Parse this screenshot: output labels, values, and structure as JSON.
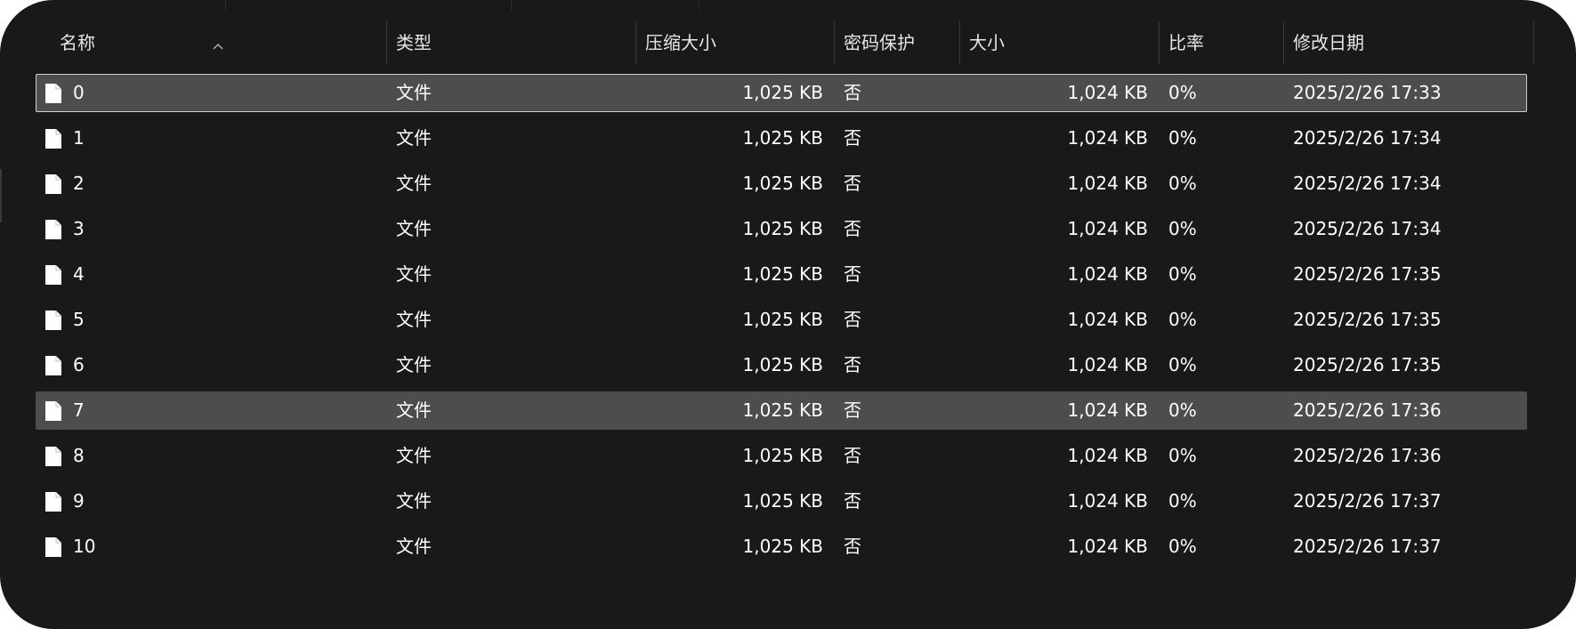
{
  "colors": {
    "background": "#191919",
    "selected_row": "#4d4d4d",
    "focus_border": "#d0d0d0",
    "text": "#ffffff"
  },
  "columns": {
    "name": "名称",
    "type": "类型",
    "compressed_size": "压缩大小",
    "password": "密码保护",
    "size": "大小",
    "ratio": "比率",
    "modified": "修改日期"
  },
  "sort": {
    "column": "name",
    "direction": "ascending",
    "icon": "chevron-up-icon"
  },
  "rows": [
    {
      "name": "0",
      "type": "文件",
      "compressed_size": "1,025 KB",
      "password": "否",
      "size": "1,024 KB",
      "ratio": "0%",
      "modified": "2025/2/26 17:33",
      "icon": "file-icon",
      "selected": true,
      "focused": true
    },
    {
      "name": "1",
      "type": "文件",
      "compressed_size": "1,025 KB",
      "password": "否",
      "size": "1,024 KB",
      "ratio": "0%",
      "modified": "2025/2/26 17:34",
      "icon": "file-icon",
      "selected": false,
      "focused": false
    },
    {
      "name": "2",
      "type": "文件",
      "compressed_size": "1,025 KB",
      "password": "否",
      "size": "1,024 KB",
      "ratio": "0%",
      "modified": "2025/2/26 17:34",
      "icon": "file-icon",
      "selected": false,
      "focused": false
    },
    {
      "name": "3",
      "type": "文件",
      "compressed_size": "1,025 KB",
      "password": "否",
      "size": "1,024 KB",
      "ratio": "0%",
      "modified": "2025/2/26 17:34",
      "icon": "file-icon",
      "selected": false,
      "focused": false
    },
    {
      "name": "4",
      "type": "文件",
      "compressed_size": "1,025 KB",
      "password": "否",
      "size": "1,024 KB",
      "ratio": "0%",
      "modified": "2025/2/26 17:35",
      "icon": "file-icon",
      "selected": false,
      "focused": false
    },
    {
      "name": "5",
      "type": "文件",
      "compressed_size": "1,025 KB",
      "password": "否",
      "size": "1,024 KB",
      "ratio": "0%",
      "modified": "2025/2/26 17:35",
      "icon": "file-icon",
      "selected": false,
      "focused": false
    },
    {
      "name": "6",
      "type": "文件",
      "compressed_size": "1,025 KB",
      "password": "否",
      "size": "1,024 KB",
      "ratio": "0%",
      "modified": "2025/2/26 17:35",
      "icon": "file-icon",
      "selected": false,
      "focused": false
    },
    {
      "name": "7",
      "type": "文件",
      "compressed_size": "1,025 KB",
      "password": "否",
      "size": "1,024 KB",
      "ratio": "0%",
      "modified": "2025/2/26 17:36",
      "icon": "file-icon",
      "selected": true,
      "focused": false
    },
    {
      "name": "8",
      "type": "文件",
      "compressed_size": "1,025 KB",
      "password": "否",
      "size": "1,024 KB",
      "ratio": "0%",
      "modified": "2025/2/26 17:36",
      "icon": "file-icon",
      "selected": false,
      "focused": false
    },
    {
      "name": "9",
      "type": "文件",
      "compressed_size": "1,025 KB",
      "password": "否",
      "size": "1,024 KB",
      "ratio": "0%",
      "modified": "2025/2/26 17:37",
      "icon": "file-icon",
      "selected": false,
      "focused": false
    },
    {
      "name": "10",
      "type": "文件",
      "compressed_size": "1,025 KB",
      "password": "否",
      "size": "1,024 KB",
      "ratio": "0%",
      "modified": "2025/2/26 17:37",
      "icon": "file-icon",
      "selected": false,
      "focused": false
    }
  ]
}
